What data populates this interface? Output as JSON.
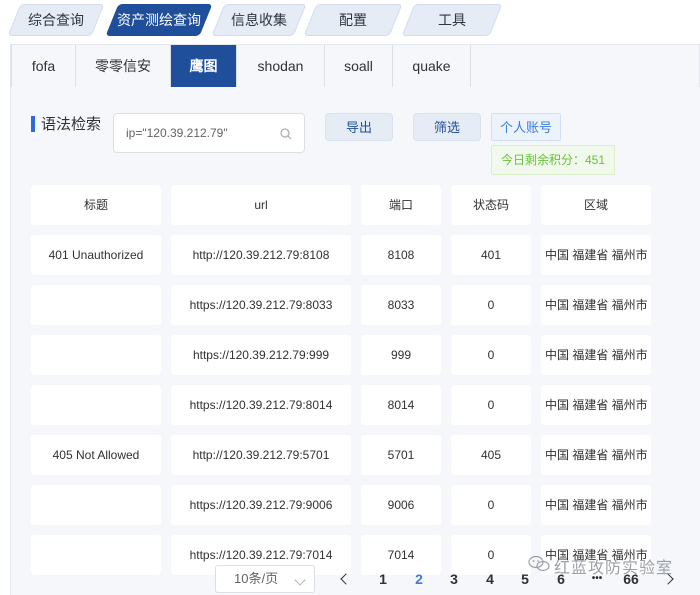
{
  "top_tabs": [
    {
      "label": "综合查询",
      "active": false
    },
    {
      "label": "资产测绘查询",
      "active": true
    },
    {
      "label": "信息收集",
      "active": false
    },
    {
      "label": "配置",
      "active": false
    },
    {
      "label": "工具",
      "active": false
    }
  ],
  "sub_tabs": [
    {
      "label": "fofa",
      "active": false
    },
    {
      "label": "零零信安",
      "active": false
    },
    {
      "label": "鹰图",
      "active": true
    },
    {
      "label": "shodan",
      "active": false
    },
    {
      "label": "soall",
      "active": false
    },
    {
      "label": "quake",
      "active": false
    }
  ],
  "search": {
    "label": "语法检索",
    "value": "ip=\"120.39.212.79\""
  },
  "buttons": {
    "export": "导出",
    "filter": "筛选",
    "account": "个人账号"
  },
  "points_text": "今日剩余积分：451",
  "table": {
    "headers": [
      "标题",
      "url",
      "端口",
      "状态码",
      "区域"
    ],
    "rows": [
      [
        "401 Unauthorized",
        "http://120.39.212.79:8108",
        "8108",
        "401",
        "中国 福建省 福州市"
      ],
      [
        "",
        "https://120.39.212.79:8033",
        "8033",
        "0",
        "中国 福建省 福州市"
      ],
      [
        "",
        "https://120.39.212.79:999",
        "999",
        "0",
        "中国 福建省 福州市"
      ],
      [
        "",
        "https://120.39.212.79:8014",
        "8014",
        "0",
        "中国 福建省 福州市"
      ],
      [
        "405 Not Allowed",
        "http://120.39.212.79:5701",
        "5701",
        "405",
        "中国 福建省 福州市"
      ],
      [
        "",
        "https://120.39.212.79:9006",
        "9006",
        "0",
        "中国 福建省 福州市"
      ],
      [
        "",
        "https://120.39.212.79:7014",
        "7014",
        "0",
        "中国 福建省 福州市"
      ]
    ]
  },
  "pagination": {
    "page_size": "10条/页",
    "pages": [
      "1",
      "2",
      "3",
      "4",
      "5",
      "6",
      "•••",
      "66"
    ],
    "current": "2"
  },
  "watermark": "红蓝攻防实验室",
  "colors": {
    "active_tab": "#1f4e9a",
    "accent": "#3b7de0",
    "points_green": "#67c23a"
  }
}
